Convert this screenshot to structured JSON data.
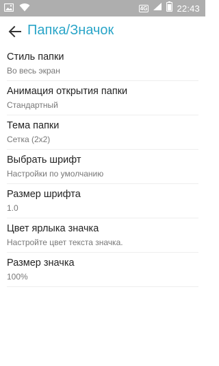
{
  "status_bar": {
    "network": "4G",
    "time": "22:43",
    "icons": [
      "image-notification-icon",
      "wifi-icon",
      "network-badge",
      "sim-signal-icon",
      "battery-icon"
    ]
  },
  "app_bar": {
    "back_icon": "arrow-left-icon",
    "title": "Папка/Значок",
    "title_color": "#2aa5c8"
  },
  "settings": [
    {
      "title": "Стиль папки",
      "summary": "Во весь экран"
    },
    {
      "title": "Анимация открытия папки",
      "summary": "Стандартный"
    },
    {
      "title": "Тема папки",
      "summary": "Сетка (2x2)"
    },
    {
      "title": "Выбрать шрифт",
      "summary": "Настройки по умолчанию"
    },
    {
      "title": "Размер шрифта",
      "summary": "1.0"
    },
    {
      "title": "Цвет ярлыка значка",
      "summary": "Настройте цвет текста значка."
    },
    {
      "title": "Размер значка",
      "summary": "100%"
    }
  ]
}
